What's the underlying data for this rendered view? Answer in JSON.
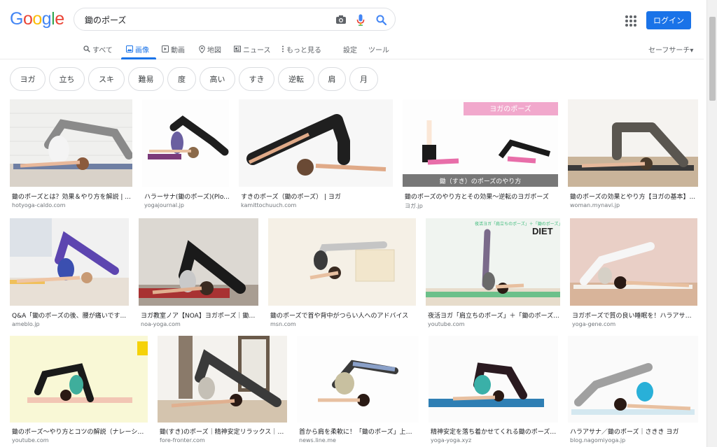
{
  "logo": {
    "letters": [
      "G",
      "o",
      "o",
      "g",
      "l",
      "e"
    ],
    "colors": [
      "#4285f4",
      "#ea4335",
      "#fbbc05",
      "#4285f4",
      "#34a853",
      "#ea4335"
    ]
  },
  "search": {
    "query": "鋤のポーズ"
  },
  "header": {
    "login_label": "ログイン"
  },
  "nav": {
    "items": [
      {
        "label": "すべて",
        "icon": "search-icon"
      },
      {
        "label": "画像",
        "icon": "image-icon"
      },
      {
        "label": "動画",
        "icon": "video-icon"
      },
      {
        "label": "地図",
        "icon": "map-pin-icon"
      },
      {
        "label": "ニュース",
        "icon": "news-icon"
      },
      {
        "label": "もっと見る",
        "icon": "more-vert-icon"
      },
      {
        "label": "設定"
      },
      {
        "label": "ツール"
      }
    ],
    "safe_search": "セーフサーチ▾"
  },
  "chips": [
    "ヨガ",
    "立ち",
    "スキ",
    "難易",
    "度",
    "高い",
    "すき",
    "逆転",
    "肩",
    "月"
  ],
  "results": [
    {
      "caption": "鋤のポーズとは？効果＆やり方を解説 | ...",
      "source": "hotyoga-caldo.com"
    },
    {
      "caption": "ハラーサナ(鋤のポーズ)(Plo...",
      "source": "yogajournal.jp"
    },
    {
      "caption": "すきのポーズ（鋤のポーズ） | ヨガ",
      "source": "kamittochuuch.com"
    },
    {
      "caption": "鋤のポーズのやり方とその効果〜逆転のヨガポーズ",
      "source": "ヨガ.jp"
    },
    {
      "caption": "鋤のポーズの効果とやり方【ヨガの基本】...",
      "source": "woman.mynavi.jp"
    },
    {
      "caption": "Q&A「鋤のポーズの後、腰が痛いです...",
      "source": "ameblo.jp"
    },
    {
      "caption": "ヨガ教室ノア【NOA】ヨガポーズ｜鋤の...",
      "source": "noa-yoga.com"
    },
    {
      "caption": "鋤のポーズで首や背中がつらい人へのアドバイス",
      "source": "msn.com"
    },
    {
      "caption": "夜活ヨガ「肩立ちのポーズ」＋「鋤のポーズ...",
      "source": "youtube.com"
    },
    {
      "caption": "ヨガポーズで質の良い睡眠を！ハラアサナ...",
      "source": "yoga-gene.com"
    },
    {
      "caption": "鋤のポーズ〜やり方とコツの解説（ナレーショ...",
      "source": "youtube.com"
    },
    {
      "caption": "鋤(すき)のポーズ｜精神安定リラックス｜For...",
      "source": "fore-fronter.com"
    },
    {
      "caption": "首から肩を柔軟に！「鋤のポーズ」上達...",
      "source": "news.line.me"
    },
    {
      "caption": "精神安定を落ち着かせてくれる鋤のポーズ|...",
      "source": "yoga-yoga.xyz"
    },
    {
      "caption": "ハラアサナ／鋤のポーズ｜さきき ヨガ",
      "source": "blog.nagomiyoga.jp"
    }
  ],
  "overlays": {
    "r3_banner": "ヨガのポーズ",
    "r3_footer": "鋤（すき）のポーズのやり方",
    "r8_title": "DIET",
    "r8_sub": "夜活ヨガ「肩立ちのポーズ」＋「鋤のポーズ」"
  },
  "colors": {
    "accent": "#1a73e8"
  }
}
